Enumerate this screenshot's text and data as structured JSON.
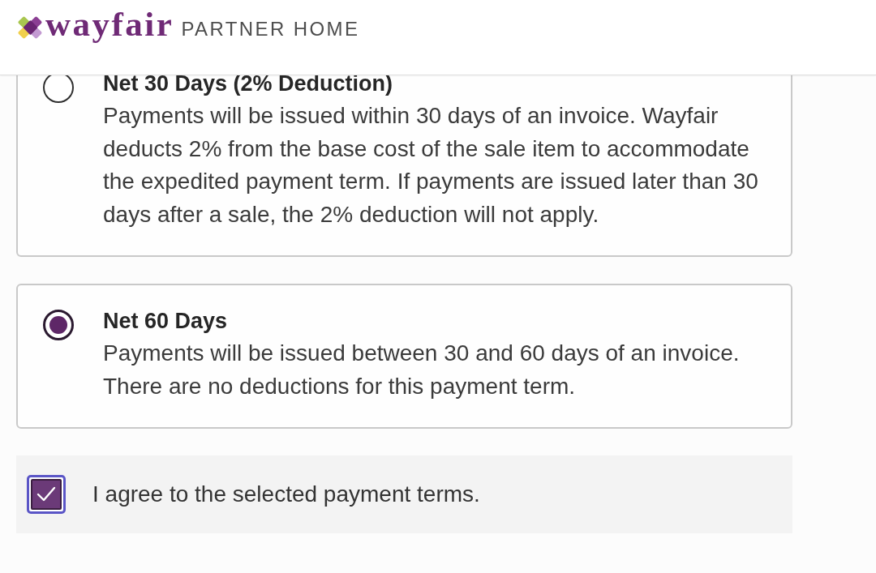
{
  "header": {
    "logo": {
      "wordmark": "wayfair",
      "product": "PARTNER HOME"
    }
  },
  "payment_terms": [
    {
      "title": "Net 30 Days (2% Deduction)",
      "description": "Payments will be issued within 30 days of an invoice. Wayfair deducts 2% from the base cost of the sale item to accommodate the expedited payment term. If payments are issued later than 30 days after a sale, the 2% deduction will not apply.",
      "selected": false
    },
    {
      "title": "Net 60 Days",
      "description": "Payments will be issued between 30 and 60 days of an invoice. There are no deductions for this payment term.",
      "selected": true
    }
  ],
  "agreement": {
    "label": "I agree to the selected payment terms.",
    "checked": true
  }
}
